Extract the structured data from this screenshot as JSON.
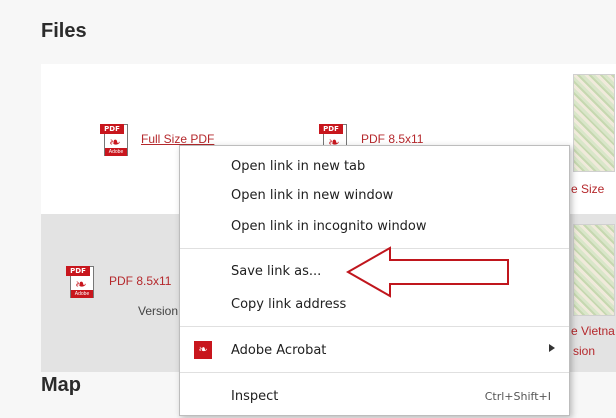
{
  "section_titles": {
    "files": "Files",
    "map": "Map"
  },
  "pdf_icon": {
    "tag": "PDF",
    "brand": "Adobe"
  },
  "file_links": {
    "full_size_pdf": "Full Size PDF",
    "pdf_85x11_top": "PDF 8.5x11",
    "pdf_85x11_bottom": "PDF 8.5x11",
    "version_text": "Version",
    "size_partial": "e Size",
    "vietnam_partial": "e Vietna",
    "version_partial": "sion"
  },
  "context_menu": {
    "items": [
      {
        "label": "Open link in new tab"
      },
      {
        "label": "Open link in new window"
      },
      {
        "label": "Open link in incognito window"
      },
      {
        "label": "Save link as..."
      },
      {
        "label": "Copy link address"
      },
      {
        "label": "Adobe Acrobat",
        "icon": "adobe-acrobat-icon",
        "submenu": true
      },
      {
        "label": "Inspect",
        "shortcut": "Ctrl+Shift+I"
      }
    ]
  },
  "colors": {
    "link": "#b5282c",
    "annotation_arrow": "#c0161d",
    "acrobat": "#c8161d"
  }
}
